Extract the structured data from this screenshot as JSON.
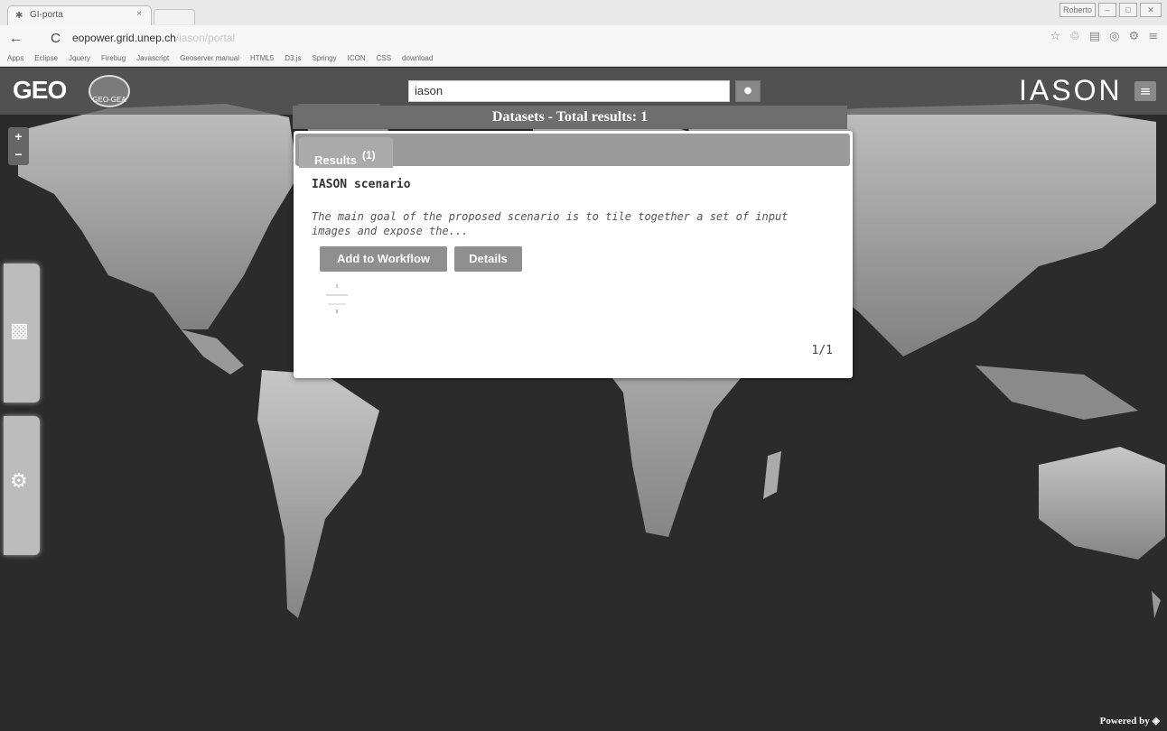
{
  "browser": {
    "tab_title": "GI-porta",
    "tab_close": "×",
    "url_host": "eopower.grid.unep.ch",
    "url_rest": "/iason/portal",
    "window_controls": {
      "user": "Roberto",
      "minimize": "–",
      "maximize": "□",
      "close": "✕"
    },
    "nav": {
      "back": "←",
      "reload": "C"
    },
    "bookmarks": [
      "Apps",
      "Eclipse",
      "Jquery",
      "Firebug",
      "Javascript",
      "Geoserver manual",
      "HTML5",
      "D3.js",
      "Springy",
      "ICON",
      "CSS",
      "download"
    ]
  },
  "header": {
    "logo_geo": "GEO",
    "logo_badge": "GEO-GEA",
    "search_value": "iason",
    "search_icon": "search-icon",
    "logo_iason": "IASON",
    "menu_icon": "hamburger-icon"
  },
  "zoom": {
    "in": "+",
    "out": "−"
  },
  "sidepanels": {
    "top_icon": "layers-icon",
    "bottom_icon": "gears-icon"
  },
  "dialog": {
    "title": "Datasets - Total results: 1",
    "tab_label": "Results",
    "tab_count": "(1)",
    "item_title": "IASON scenario",
    "item_desc": "The main goal of the proposed scenario is to tile together a set of input images and expose the...",
    "btn_add": "Add to Workflow",
    "btn_details": "Details",
    "pager": "1/1"
  },
  "footer": {
    "powered": "Powered by"
  }
}
